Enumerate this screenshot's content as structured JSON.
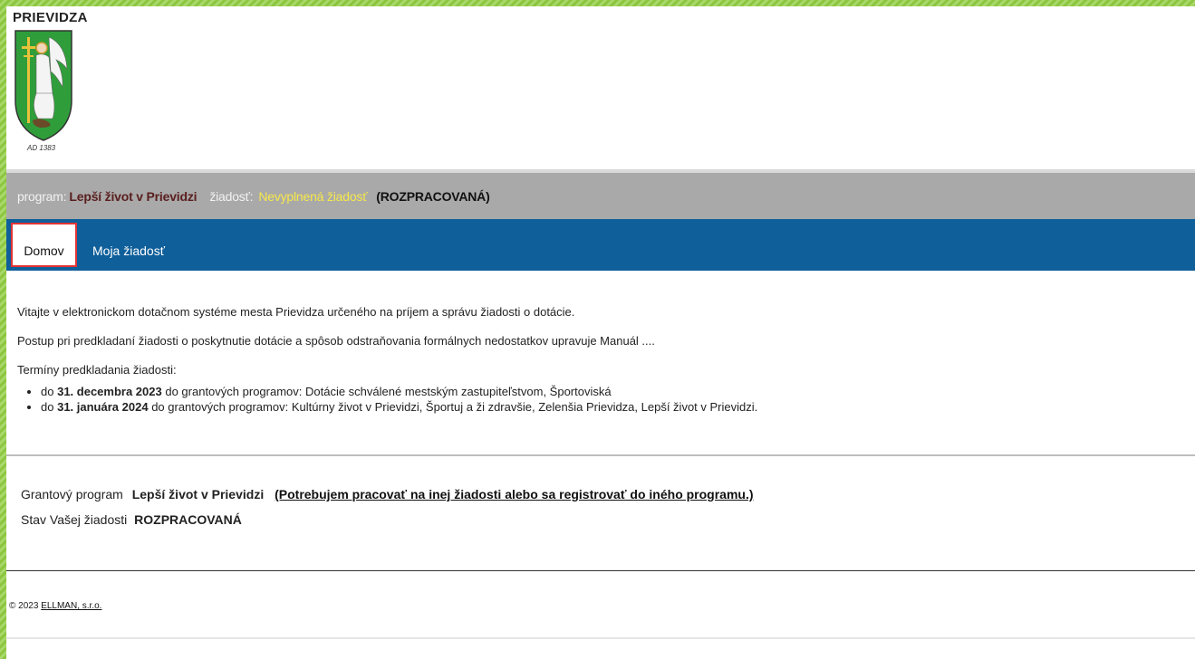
{
  "header": {
    "city_name": "PRIEVIDZA",
    "crest_caption": "AD 1383",
    "crest_icon": "prievidza-coat-of-arms-icon"
  },
  "info_bar": {
    "program_label": "program:",
    "program_value": "Lepší život v Prievidzi",
    "request_label": "žiadosť:",
    "request_value": "Nevyplnená žiadosť",
    "request_status": "(ROZPRACOVANÁ)"
  },
  "nav": {
    "tabs": [
      {
        "label": "Domov",
        "active": true
      },
      {
        "label": "Moja žiadosť",
        "active": false
      }
    ]
  },
  "content": {
    "welcome": "Vitajte v elektronickom dotačnom systéme mesta Prievidza určeného na príjem a správu žiadosti o dotácie.",
    "procedure": "Postup pri predkladaní žiadosti o poskytnutie dotácie a spôsob odstraňovania formálnych nedostatkov upravuje Manuál ....",
    "deadlines_title": "Termíny predkladania žiadosti:",
    "deadlines": [
      {
        "prefix": "do",
        "date": "31. decembra 2023",
        "text": "do grantových programov: Dotácie schválené mestským zastupiteľstvom, Športoviská"
      },
      {
        "prefix": "do",
        "date": "31. januára 2024",
        "text": "do grantových programov: Kultúrny život v Prievidzi, Športuj a ži zdravšie, Zelenšia Prievidza, Lepší život v Prievidzi."
      }
    ]
  },
  "grant": {
    "label": "Grantový program",
    "value": "Lepší život v Prievidzi",
    "link": "(Potrebujem pracovať na inej žiadosti alebo sa registrovať do iného programu.)"
  },
  "status": {
    "label": "Stav Vašej žiadosti",
    "value": "ROZPRACOVANÁ"
  },
  "footer": {
    "copyright": "© 2023",
    "company": "ELLMAN, s.r.o."
  },
  "colors": {
    "nav_blue": "#0f5f9a",
    "info_gray": "#a9a9a9",
    "highlight_yellow": "#f6e84a",
    "program_maroon": "#5a1e1e",
    "active_tab_border": "#e03434",
    "border_green": "#8cc63f"
  }
}
